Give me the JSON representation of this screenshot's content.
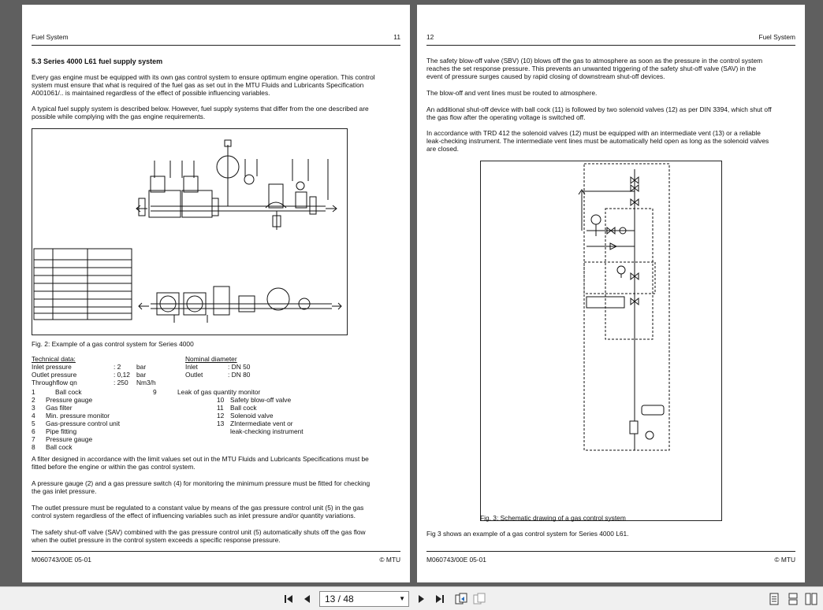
{
  "left_page": {
    "header_left": "Fuel System",
    "header_right": "11",
    "section_title": "5.3 Series 4000 L61 fuel supply system",
    "para1": "Every gas engine must be equipped with its own gas control system to ensure optimum engine operation. This control system must ensure that what is required of the fuel gas as set out in the MTU Fluids and Lubricants Specification A001061/.. is maintained regardless of the effect of possible influencing variables.",
    "para2": "A typical fuel supply system is described below. However, fuel supply systems that differ from the one described are possible while complying with the gas engine requirements.",
    "fig_caption": "Fig. 2: Example of a gas control system for Series 4000",
    "tech_title": "Technical data:",
    "tech_rows": [
      {
        "label": "Inlet pressure",
        "value": ": 2",
        "unit": "bar"
      },
      {
        "label": "Outlet pressure",
        "value": ": 0,12",
        "unit": "bar"
      },
      {
        "label": "Throughflow qn",
        "value": ": 250",
        "unit": "Nm3/h"
      }
    ],
    "nominal_title": "Nominal diameter",
    "nominal_rows": [
      {
        "label": "Inlet",
        "value": ": DN 50"
      },
      {
        "label": "Outlet",
        "value": ": DN 80"
      }
    ],
    "parts_left": [
      {
        "num": "1",
        "text": "Ball cock"
      },
      {
        "num": "2",
        "text": "Pressure gauge"
      },
      {
        "num": "3",
        "text": "Gas filter"
      },
      {
        "num": "4",
        "text": "Min. pressure monitor"
      },
      {
        "num": "5",
        "text": "Gas-pressure control unit"
      },
      {
        "num": "6",
        "text": "Pipe fitting"
      },
      {
        "num": "7",
        "text": "Pressure gauge"
      },
      {
        "num": "8",
        "text": "Ball cock"
      }
    ],
    "parts_9": {
      "num": "9",
      "text": "Leak of gas quantity monitor"
    },
    "parts_right": [
      {
        "num": "10",
        "text": "Safety blow-off valve"
      },
      {
        "num": "11",
        "text": "Ball cock"
      },
      {
        "num": "12",
        "text": "Solenoid valve"
      },
      {
        "num": "13",
        "text": "ZIntermediate vent or"
      },
      {
        "num": "",
        "text": "leak-checking instrument"
      }
    ],
    "para3": "A filter designed in accordance with the limit values set out in the MTU Fluids and Lubricants Specifications must be fitted before the engine or within the gas control system.",
    "para4": "A pressure gauge (2) and a gas pressure switch (4) for monitoring the minimum pressure must be fitted for checking the gas inlet pressure.",
    "para5": "The outlet pressure must be regulated to a constant value by means of the gas pressure control unit (5) in the gas control system regardless of the effect of influencing variables such as inlet pressure and/or quantity variations.",
    "para6": "The safety shut-off valve (SAV) combined with the gas pressure control unit (5) automatically shuts off the gas flow when the outlet pressure in the control system exceeds a specific response pressure.",
    "footer_left": "M060743/00E 05-01",
    "footer_right": "© MTU"
  },
  "right_page": {
    "header_left": "12",
    "header_right": "Fuel System",
    "para1": "The safety blow-off valve (SBV) (10) blows off the gas to atmosphere as soon as the pressure in the control system reaches the set response pressure. This prevents an unwanted triggering of the safety shut-off valve (SAV) in the event of pressure surges caused by rapid closing of downstream shut-off devices.",
    "para2": "The blow-off and vent lines must be routed to atmosphere.",
    "para3": "An additional shut-off device with ball cock (11) is followed by two solenoid valves (12) as per DIN 3394, which shut off the gas flow after the operating voltage is switched off.",
    "para4": "In accordance with TRD 412 the solenoid valves (12) must be equipped with an intermediate vent (13) or a reliable leak-checking instrument. The intermediate vent lines must be automatically held open as long as the solenoid valves are closed.",
    "fig_caption": "Fig. 3: Schematic drawing of a gas control system",
    "para5": "Fig 3 shows an example of a gas control system for Series 4000 L61.",
    "footer_left": "M060743/00E 05-01",
    "footer_right": "© MTU"
  },
  "toolbar": {
    "page_display": "13 / 48"
  }
}
